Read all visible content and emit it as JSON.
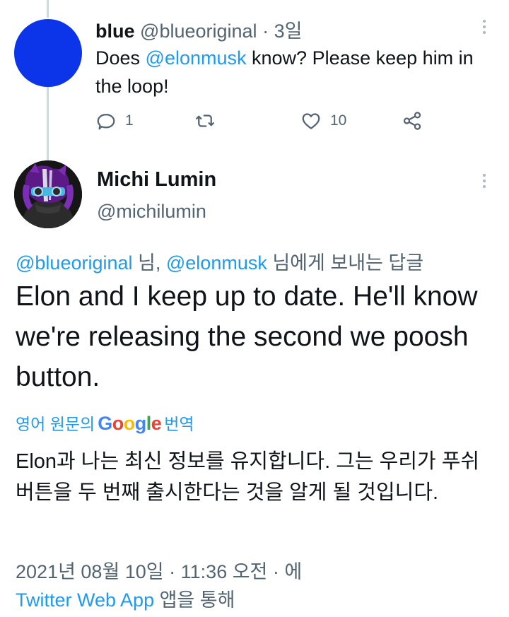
{
  "parent_tweet": {
    "name": "blue",
    "handle": "@blueoriginal",
    "separator": "·",
    "time": "3일",
    "text_before_mention": "Does ",
    "mention": "@elonmusk",
    "text_after_mention": " know? Please keep him in the loop!",
    "reply_count": "1",
    "like_count": "10",
    "avatar_color": "#0c34e8"
  },
  "main_tweet": {
    "name": "Michi Lumin",
    "handle": "@michilumin",
    "replying_mention_1": "@blueoriginal",
    "replying_middle": " 님, ",
    "replying_mention_2": "@elonmusk",
    "replying_suffix": " 님에게 보내는 답글",
    "text": "Elon and I keep up to date. He'll know we're releasing the second we poosh button.",
    "translate_prefix": "영어 원문의",
    "translate_brand": {
      "G": "G",
      "o1": "o",
      "o2": "o",
      "g": "g",
      "l": "l",
      "e": "e"
    },
    "translate_suffix": "번역",
    "translated_text": "Elon과 나는 최신 정보를 유지합니다. 그는 우리가 푸쉬 버튼을 두 번째 출시한다는 것을 알게 될 것입니다.",
    "timestamp": "2021년 08월 10일 · 11:36 오전 · 에",
    "source_app": "Twitter Web App",
    "source_suffix": " 앱을 통해"
  },
  "icons": {
    "reply": "reply-icon",
    "retweet": "retweet-icon",
    "like": "heart-icon",
    "share": "share-icon",
    "more": "more-options-icon"
  },
  "colors": {
    "link": "#1d9bf0",
    "secondary_text": "#536471",
    "primary_text": "#0f1419"
  }
}
